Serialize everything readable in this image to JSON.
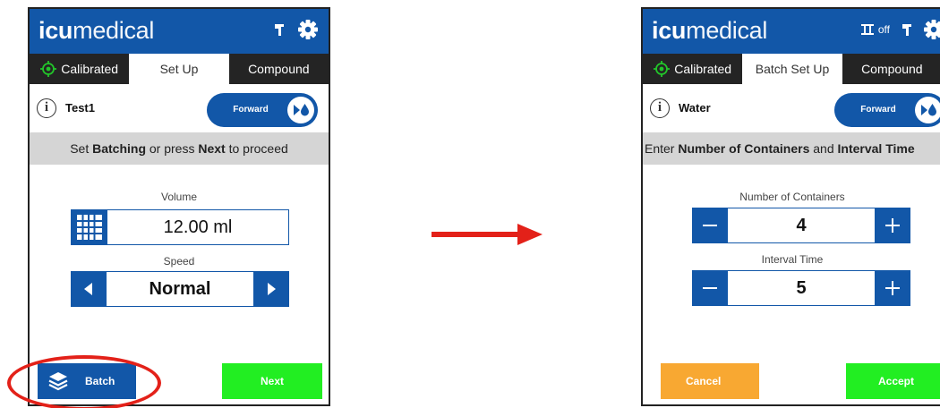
{
  "left": {
    "logo": {
      "bold": "icu",
      "light": "medical"
    },
    "tabs": [
      {
        "label": "Calibrated",
        "icon": "calibrated-icon"
      },
      {
        "label": "Set Up"
      },
      {
        "label": "Compound"
      }
    ],
    "drug": "Test1",
    "direction": "Forward",
    "prompt": {
      "p1": "Set ",
      "b1": "Batching",
      "p2": " or press ",
      "b2": "Next",
      "p3": " to proceed"
    },
    "volume": {
      "label": "Volume",
      "value": "12.00 ml"
    },
    "speed": {
      "label": "Speed",
      "value": "Normal"
    },
    "batch_label": "Batch",
    "next_label": "Next"
  },
  "right": {
    "logo": {
      "bold": "icu",
      "light": "medical"
    },
    "off_label": "off",
    "tabs": [
      {
        "label": "Calibrated",
        "icon": "calibrated-icon"
      },
      {
        "label": "Batch Set Up"
      },
      {
        "label": "Compound"
      }
    ],
    "drug": "Water",
    "direction": "Forward",
    "prompt": {
      "p1": "Enter ",
      "b1": "Number of Containers",
      "p2": " and ",
      "b2": "Interval Time"
    },
    "containers": {
      "label": "Number of Containers",
      "value": "4"
    },
    "interval": {
      "label": "Interval Time",
      "value": "5"
    },
    "cancel_label": "Cancel",
    "accept_label": "Accept"
  },
  "colors": {
    "brand_blue": "#1257a8",
    "tab_bar": "#242424",
    "calibrated_green": "#22c52a",
    "next_green": "#22ee22",
    "cancel_orange": "#f8a832",
    "callout_red": "#e32119"
  }
}
